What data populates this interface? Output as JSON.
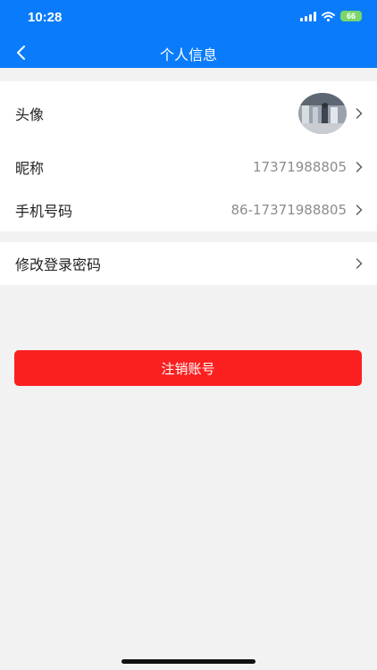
{
  "status_bar": {
    "time": "10:28",
    "battery": "66"
  },
  "header": {
    "title": "个人信息"
  },
  "profile": {
    "avatar_label": "头像",
    "nickname_label": "昵称",
    "nickname_value": "17371988805",
    "phone_label": "手机号码",
    "phone_value": "86-17371988805"
  },
  "security": {
    "change_password_label": "修改登录密码"
  },
  "actions": {
    "delete_account": "注销账号"
  },
  "colors": {
    "accent": "#0a7cfb",
    "danger": "#fb2020",
    "background": "#f2f2f2"
  }
}
